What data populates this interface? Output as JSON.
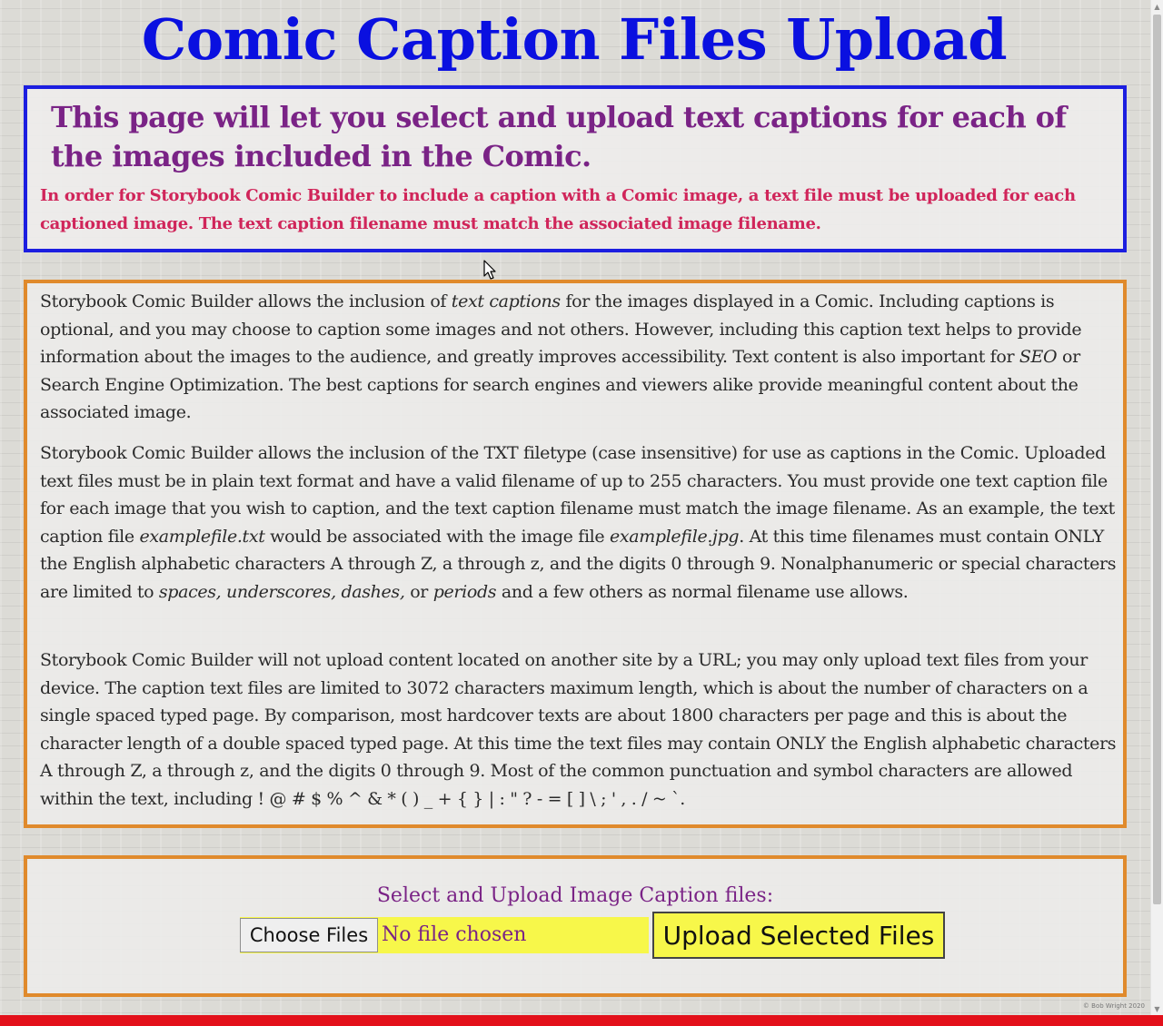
{
  "page": {
    "title": "Comic Caption Files Upload",
    "intro_heading": "This page will let you select and upload text captions for each of the images included in the Comic.",
    "intro_note": "In order for Storybook Comic Builder to include a caption with a Comic image, a text file must be uploaded for each captioned image. The text caption filename must match the associated image filename."
  },
  "info": {
    "p1": {
      "a": "Storybook Comic Builder allows the inclusion of ",
      "b_em": "text captions",
      "c": " for the images displayed in a Comic. Including captions is optional, and you may choose to caption some images and not others. However, including this caption text helps to provide information about the images to the audience, and greatly improves accessibility. Text content is also important for ",
      "d_em": "SEO",
      "e": " or Search Engine Optimization. The best captions for search engines and viewers alike provide meaningful content about the associated image."
    },
    "p2": {
      "a": "Storybook Comic Builder allows the inclusion of the TXT filetype (case insensitive) for use as captions in the Comic. Uploaded text files must be in plain text format and have a valid filename of up to 255 characters. You must provide one text caption file for each image that you wish to caption, and the text caption filename must match the image filename. As an example, the text caption file ",
      "b_em": "examplefile.txt",
      "c": " would be associated with the image file ",
      "d_em": "examplefile.jpg",
      "e": ". At this time filenames must contain ONLY the English alphabetic characters A through Z, a through z, and the digits 0 through 9. Nonalphanumeric or special characters are limited to ",
      "f_em": "spaces, underscores, dashes,",
      "g": " or ",
      "h_em": "periods",
      "i": " and a few others as normal filename use allows."
    },
    "p3": "Storybook Comic Builder will not upload content located on another site by a URL; you may only upload text files from your device. The caption text files are limited to 3072 characters maximum length, which is about the number of characters on a single spaced typed page. By comparison, most hardcover texts are about 1800 characters per page and this is about the character length of a double spaced typed page. At this time the text files may contain ONLY the English alphabetic characters A through Z, a through z, and the digits 0 through 9. Most of the common punctuation and symbol characters are allowed within the text, including ! @ # $ % ^ & * ( ) _ + { } | : \" ? - = [ ] \\ ; ' , . / ~ `."
  },
  "upload": {
    "label": "Select and Upload Image Caption files:",
    "choose_button": "Choose Files",
    "no_file_text": "No file chosen",
    "submit_button": "Upload Selected Files"
  },
  "footer": {
    "copyright": "© Bob Wright 2020"
  },
  "icons": {
    "cursor": "mouse-pointer-icon",
    "scroll_up": "scroll-up-arrow-icon",
    "scroll_down": "scroll-down-arrow-icon"
  },
  "colors": {
    "title": "#0a10e0",
    "intro_border": "#1c1ee0",
    "heading_purple": "#7a2386",
    "note_red": "#d0255a",
    "info_border": "#e08a2c",
    "button_yellow": "#f7f74a",
    "footer_red": "#e3101a"
  }
}
